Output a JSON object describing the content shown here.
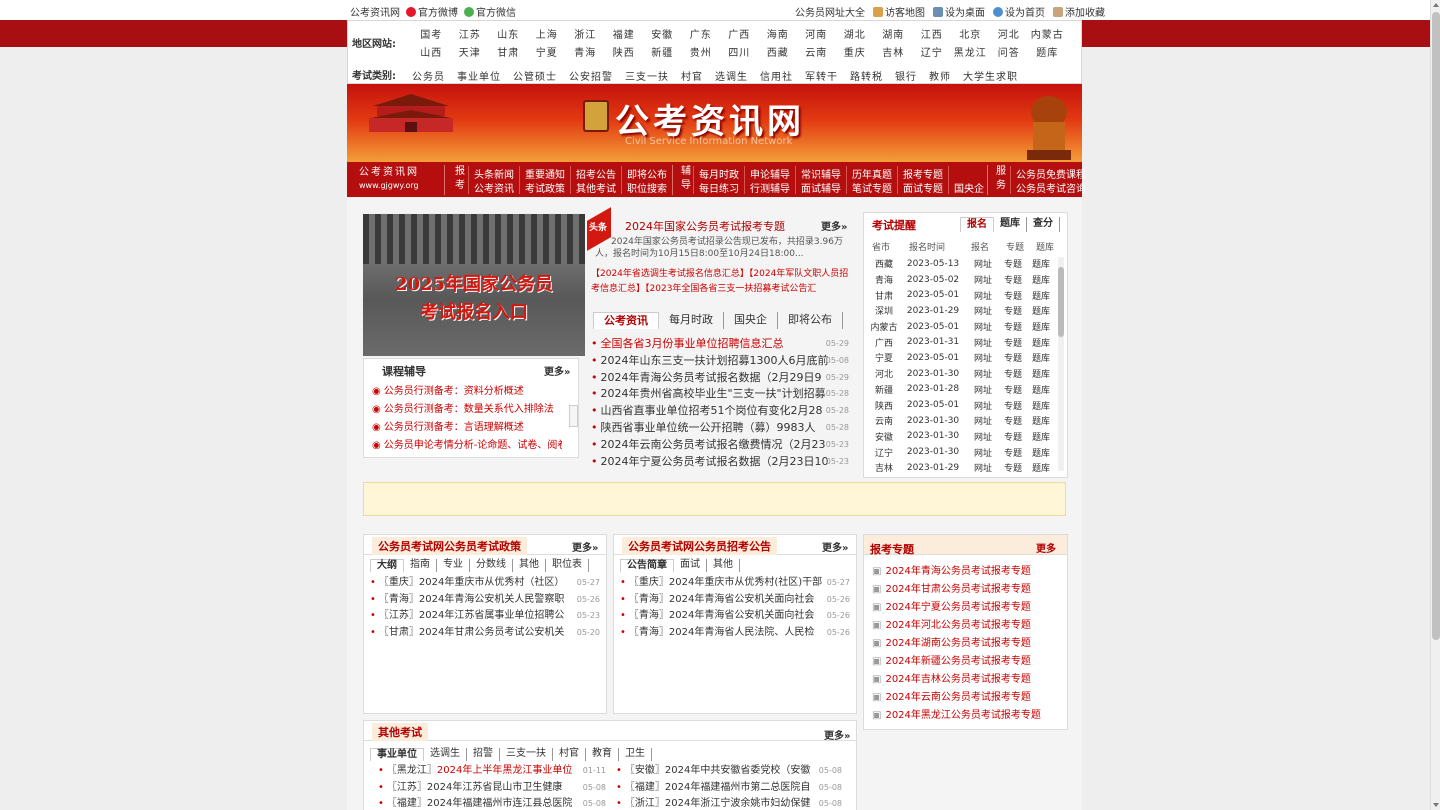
{
  "topbar": {
    "left": [
      "公考资讯网",
      "官方微博",
      "官方微信"
    ],
    "right": [
      "公务员网址大全",
      "访客地图",
      "设为桌面",
      "设为首页",
      "添加收藏"
    ]
  },
  "nav": {
    "region_label": "地区网站:",
    "region_row1": [
      "国考",
      "江苏",
      "山东",
      "上海",
      "浙江",
      "福建",
      "安徽",
      "广东",
      "广西",
      "海南",
      "河南",
      "湖北",
      "湖南",
      "江西",
      "北京",
      "河北",
      "内蒙古"
    ],
    "region_row2": [
      "山西",
      "天津",
      "甘肃",
      "宁夏",
      "青海",
      "陕西",
      "新疆",
      "贵州",
      "四川",
      "西藏",
      "云南",
      "重庆",
      "吉林",
      "辽宁",
      "黑龙江",
      "问答",
      "题库"
    ],
    "category_label": "考试类别:",
    "category_row": [
      "公务员",
      "事业单位",
      "公管硕士",
      "公安招警",
      "三支一扶",
      "村官",
      "选调生",
      "信用社",
      "军转干",
      "路转税",
      "银行",
      "教师",
      "大学生求职"
    ]
  },
  "banner": {
    "title": "公考资讯网",
    "subtitle": "Civil Service Information Network"
  },
  "menu": {
    "site_name": "公考资讯网",
    "site_url": "www.gjgwy.org",
    "bao_label": "报考",
    "bao_items": [
      "头条新闻",
      "公考资讯",
      "重要通知",
      "考试政策",
      "招考公告",
      "其他考试",
      "即将公布",
      "职位搜索"
    ],
    "fu_label": "辅导",
    "fu_items": [
      "每月时政",
      "每日练习",
      "申论辅导",
      "行测辅导",
      "常识辅导",
      "面试辅导",
      "历年真题",
      "笔试专题",
      "报考专题",
      "面试专题",
      "",
      "国央企"
    ],
    "service_label": "服务",
    "service_items": [
      "公务员免费课程",
      "公务员考试咨询"
    ]
  },
  "slide": {
    "line1": "2025年国家公务员",
    "line2": "考试报名入口"
  },
  "course": {
    "title": "课程辅导",
    "more": "更多»",
    "items": [
      "公务员行测备考：资料分析概述",
      "公务员行测备考：数量关系代入排除法",
      "公务员行测备考：言语理解概述",
      "公务员申论考情分析-论命题、试卷、阅卷、"
    ]
  },
  "headline": {
    "tag": "头条",
    "title": "2024年国家公务员考试报考专题",
    "more": "更多»",
    "summary": "2024年国家公务员考试招录公告现已发布，共招录3.96万人，报名时间为10月15日8:00至10月24日18:00...",
    "links": [
      "【2024年省选调生考试报名信息汇总】",
      "【2024年军队文职人员招考信息汇总】",
      "【2023年全国各省三支一扶招募考试公告汇"
    ]
  },
  "news": {
    "tabs": [
      "公考资讯",
      "每月时政",
      "国央企",
      "即将公布"
    ],
    "items": [
      {
        "t": "全国各省3月份事业单位招聘信息汇总",
        "d": "05-29",
        "red": true
      },
      {
        "t": "2024年山东三支一扶计划招募1300人6月底前",
        "d": "05-08",
        "red": false
      },
      {
        "t": "2024年青海公务员考试报名数据（2月29日9",
        "d": "05-29",
        "red": false
      },
      {
        "t": "2024年贵州省高校毕业生\"三支一扶\"计划招募",
        "d": "05-28",
        "red": false
      },
      {
        "t": "山西省直事业单位招考51个岗位有变化2月28",
        "d": "05-28",
        "red": false
      },
      {
        "t": "陕西省事业单位统一公开招聘（募）9983人",
        "d": "05-28",
        "red": false
      },
      {
        "t": "2024年云南公务员考试报名缴费情况（2月23",
        "d": "05-23",
        "red": false
      },
      {
        "t": "2024年宁夏公务员考试报名数据（2月23日10",
        "d": "05-23",
        "red": false
      }
    ]
  },
  "exam": {
    "title": "考试提醒",
    "tabs": [
      "报名",
      "题库",
      "查分"
    ],
    "headers": [
      "省市",
      "报名时间",
      "报名",
      "专题",
      "题库"
    ],
    "rows": [
      [
        "西藏",
        "2023-05-13"
      ],
      [
        "青海",
        "2023-05-02"
      ],
      [
        "甘肃",
        "2023-05-01"
      ],
      [
        "深圳",
        "2023-01-29"
      ],
      [
        "内蒙古",
        "2023-05-01"
      ],
      [
        "广西",
        "2023-01-31"
      ],
      [
        "宁夏",
        "2023-05-01"
      ],
      [
        "河北",
        "2023-01-30"
      ],
      [
        "新疆",
        "2023-01-28"
      ],
      [
        "陕西",
        "2023-05-01"
      ],
      [
        "云南",
        "2023-01-30"
      ],
      [
        "安徽",
        "2023-01-30"
      ],
      [
        "辽宁",
        "2023-01-30"
      ],
      [
        "吉林",
        "2023-01-29"
      ]
    ],
    "col_link": "网址",
    "col_topic": "专题",
    "col_bank": "题库"
  },
  "policy": {
    "title": "公务员考试网公务员考试政策",
    "more": "更多»",
    "tabs": [
      "大纲",
      "指南",
      "专业",
      "分数线",
      "其他",
      "职位表"
    ],
    "items": [
      {
        "t": "〖重庆〗2024年重庆市从优秀村（社区）",
        "d": "05-27"
      },
      {
        "t": "〖青海〗2024年青海公安机关人民警察职",
        "d": "05-26"
      },
      {
        "t": "〖江苏〗2024年江苏省属事业单位招聘公",
        "d": "05-23"
      },
      {
        "t": "〖甘肃〗2024年甘肃公务员考试公安机关",
        "d": "05-20"
      }
    ]
  },
  "notice": {
    "title": "公务员考试网公务员招考公告",
    "more": "更多»",
    "tabs": [
      "公告简章",
      "面试",
      "其他"
    ],
    "items": [
      {
        "t": "〖重庆〗2024年重庆市从优秀村(社区)干部",
        "d": "05-27"
      },
      {
        "t": "〖青海〗2024年青海省公安机关面向社会",
        "d": "05-26"
      },
      {
        "t": "〖青海〗2024年青海省公安机关面向社会",
        "d": "05-26"
      },
      {
        "t": "〖青海〗2024年青海省人民法院、人民检",
        "d": "05-26"
      }
    ]
  },
  "topics": {
    "title": "报考专题",
    "more": "更多",
    "items": [
      "2024年青海公务员考试报考专题",
      "2024年甘肃公务员考试报考专题",
      "2024年宁夏公务员考试报考专题",
      "2024年河北公务员考试报考专题",
      "2024年湖南公务员考试报考专题",
      "2024年新疆公务员考试报考专题",
      "2024年吉林公务员考试报考专题",
      "2024年云南公务员考试报考专题",
      "2024年黑龙江公务员考试报考专题"
    ]
  },
  "other": {
    "title": "其他考试",
    "more": "更多»",
    "tabs": [
      "事业单位",
      "选调生",
      "招警",
      "三支一扶",
      "村官",
      "教育",
      "卫生"
    ],
    "left": [
      {
        "p": "〖黑龙江〗",
        "t": "2024年上半年黑龙江事业单位",
        "d": "01-11",
        "red": true
      },
      {
        "p": "〖江苏〗",
        "t": "2024年江苏省昆山市卫生健康",
        "d": "05-08",
        "red": false
      },
      {
        "p": "〖福建〗",
        "t": "2024年福建福州市连江县总医院",
        "d": "05-08",
        "red": false
      }
    ],
    "right": [
      {
        "p": "〖安徽〗",
        "t": "2024年中共安徽省委党校（安徽",
        "d": "05-08"
      },
      {
        "p": "〖福建〗",
        "t": "2024年福建福州市第二总医院自",
        "d": "05-08"
      },
      {
        "p": "〖浙江〗",
        "t": "2024年浙江宁波余姚市妇幼保健",
        "d": "05-08"
      }
    ]
  }
}
